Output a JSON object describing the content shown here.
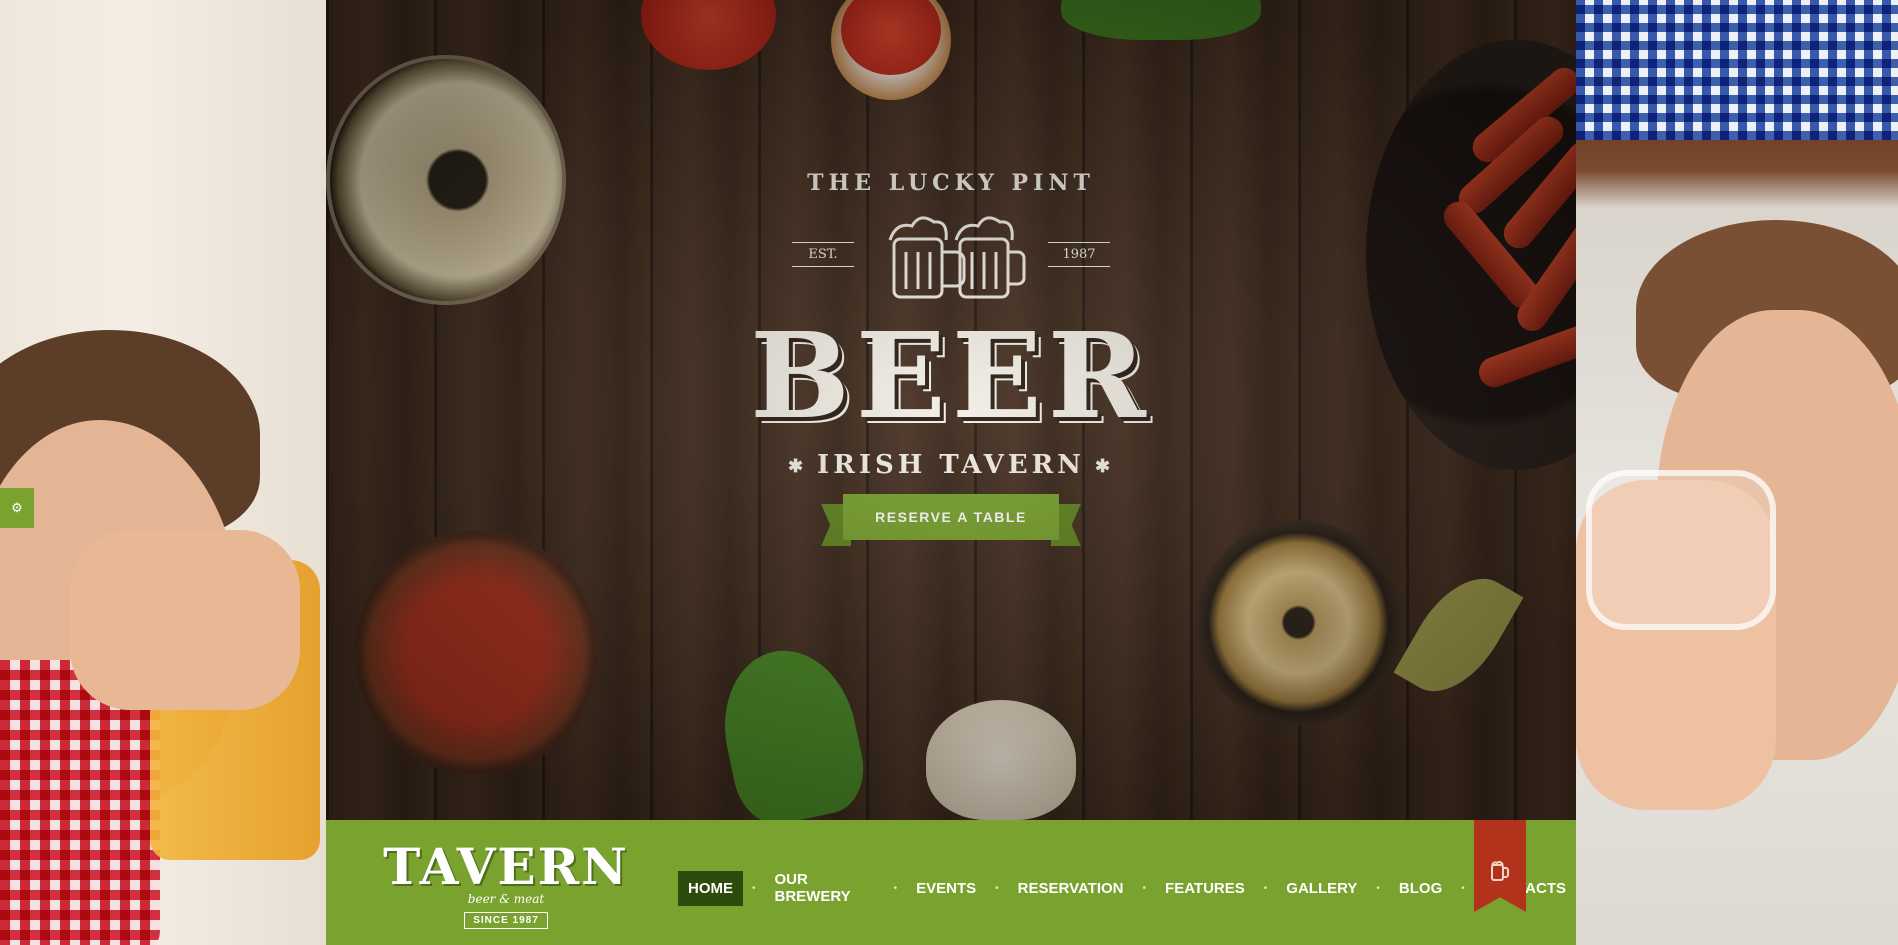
{
  "hero": {
    "tagline_top": "THE LUCKY PINT",
    "est_label": "EST.",
    "est_year": "1987",
    "main_title": "BEER",
    "subtitle": "IRISH TAVERN",
    "star_glyph": "✱",
    "cta_label": "RESERVE A TABLE"
  },
  "brand": {
    "name": "TAVERN",
    "sub": "beer & meat",
    "since": "SINCE 1987"
  },
  "nav": {
    "items": [
      {
        "label": "HOME",
        "active": true
      },
      {
        "label": "OUR BREWERY"
      },
      {
        "label": "EVENTS"
      },
      {
        "label": "RESERVATION"
      },
      {
        "label": "FEATURES"
      },
      {
        "label": "GALLERY"
      },
      {
        "label": "BLOG"
      },
      {
        "label": "CONTACTS"
      }
    ],
    "separator": "•"
  },
  "icons": {
    "side_tab": "settings-icon",
    "bookmark": "beer-mug-icon"
  },
  "colors": {
    "accent_green": "#79a22e",
    "active_nav": "#2f4a0d",
    "bookmark_red": "#b3321b"
  }
}
